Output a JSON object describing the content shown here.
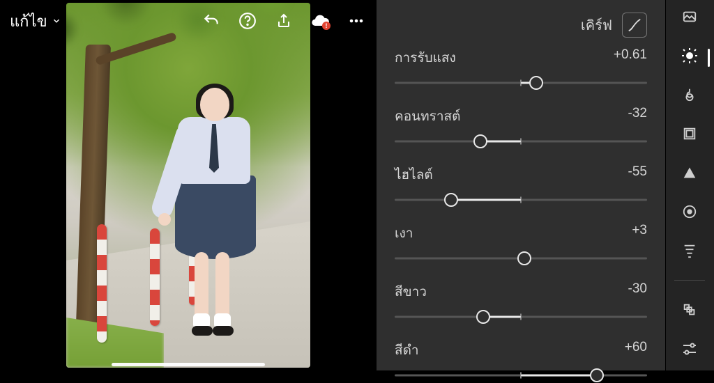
{
  "toolbar": {
    "mode_label": "แก้ไข"
  },
  "panel": {
    "curve_label": "เคิร์ฟ"
  },
  "sliders": [
    {
      "label": "การรับแสง",
      "value_text": "+0.61",
      "min": -5,
      "max": 5,
      "value": 0.61
    },
    {
      "label": "คอนทราสต์",
      "value_text": "-32",
      "min": -100,
      "max": 100,
      "value": -32
    },
    {
      "label": "ไฮไลต์",
      "value_text": "-55",
      "min": -100,
      "max": 100,
      "value": -55
    },
    {
      "label": "เงา",
      "value_text": "+3",
      "min": -100,
      "max": 100,
      "value": 3
    },
    {
      "label": "สีขาว",
      "value_text": "-30",
      "min": -100,
      "max": 100,
      "value": -30
    },
    {
      "label": "สีดำ",
      "value_text": "+60",
      "min": -100,
      "max": 100,
      "value": 60
    }
  ],
  "rail": {
    "items": [
      {
        "name": "photo-icon"
      },
      {
        "name": "light-icon"
      },
      {
        "name": "color-icon"
      },
      {
        "name": "crop-icon"
      },
      {
        "name": "effects-icon"
      },
      {
        "name": "lens-icon"
      },
      {
        "name": "geometry-icon"
      }
    ],
    "items2": [
      {
        "name": "presets-icon"
      },
      {
        "name": "adjust-icon"
      }
    ],
    "active_index": 1
  }
}
